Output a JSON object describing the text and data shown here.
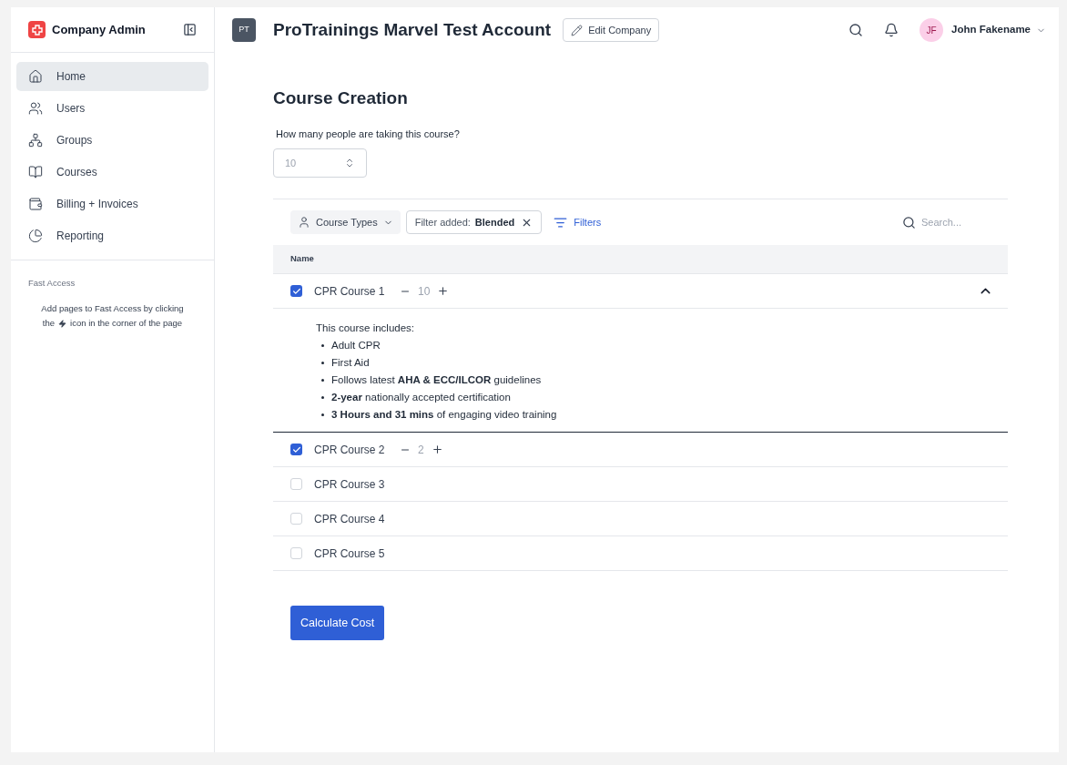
{
  "sidebar": {
    "brand": "Company Admin",
    "items": [
      {
        "label": "Home",
        "selected": true
      },
      {
        "label": "Users",
        "selected": false
      },
      {
        "label": "Groups",
        "selected": false
      },
      {
        "label": "Courses",
        "selected": false
      },
      {
        "label": "Billing + Invoices",
        "selected": false
      },
      {
        "label": "Reporting",
        "selected": false
      }
    ],
    "fast_access": {
      "title": "Fast Access",
      "line_1": "Add  pages to Fast Access by clicking",
      "line_2_before": "the",
      "line_2_after": "icon in the corner of the page"
    }
  },
  "header": {
    "company_initials": "PT",
    "company_name": "ProTrainings Marvel Test Account",
    "edit_button": "Edit Company",
    "user_initials": "JF",
    "user_name": "John Fakename"
  },
  "page_title": "Course Creation",
  "people_field": {
    "label": "How many people are taking this course?",
    "value": "10"
  },
  "toolbar": {
    "course_types": "Course Types",
    "filter_label": "Filter added:",
    "filter_value": "Blended",
    "filters_button": "Filters",
    "search_placeholder": "Search..."
  },
  "table": {
    "columns": [
      "Name"
    ],
    "rows": [
      {
        "name": "CPR Course 1",
        "checked": true,
        "quantity": "10",
        "expanded": true,
        "details": {
          "intro": "This course includes:",
          "bullets": [
            "Adult CPR",
            "First Aid",
            "Follows latest **AHA & ECC/ILCOR** guidelines",
            "**2-year** nationally accepted certification",
            "**3 Hours and 31 mins** of engaging video training"
          ]
        }
      },
      {
        "name": "CPR Course 2",
        "checked": true,
        "quantity": "2",
        "expanded": false
      },
      {
        "name": "CPR Course 3",
        "checked": false,
        "expanded": false
      },
      {
        "name": "CPR Course 4",
        "checked": false,
        "expanded": false
      },
      {
        "name": "CPR Course 5",
        "checked": false,
        "expanded": false
      }
    ]
  },
  "calculate_button": "Calculate Cost"
}
